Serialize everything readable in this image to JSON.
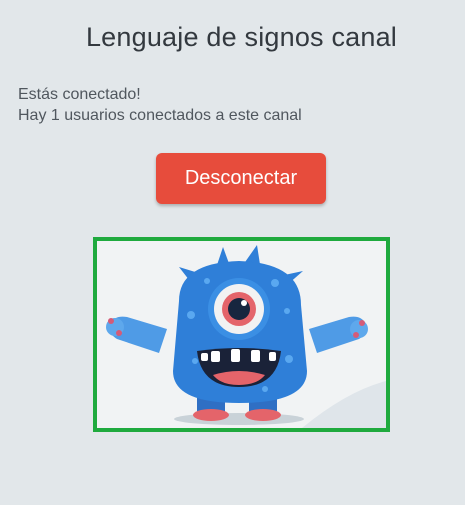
{
  "header": {
    "title": "Lenguaje de signos canal"
  },
  "status": {
    "connected_message": "Estás conectado!",
    "users_message": "Hay 1 usuarios conectados a este canal"
  },
  "actions": {
    "disconnect_label": "Desconectar"
  },
  "video": {
    "content": "monster-mascot"
  },
  "colors": {
    "background": "#e2e7ea",
    "accent_button": "#e74c3c",
    "video_border": "#1faa3e",
    "mascot_body": "#2f7fd8"
  }
}
